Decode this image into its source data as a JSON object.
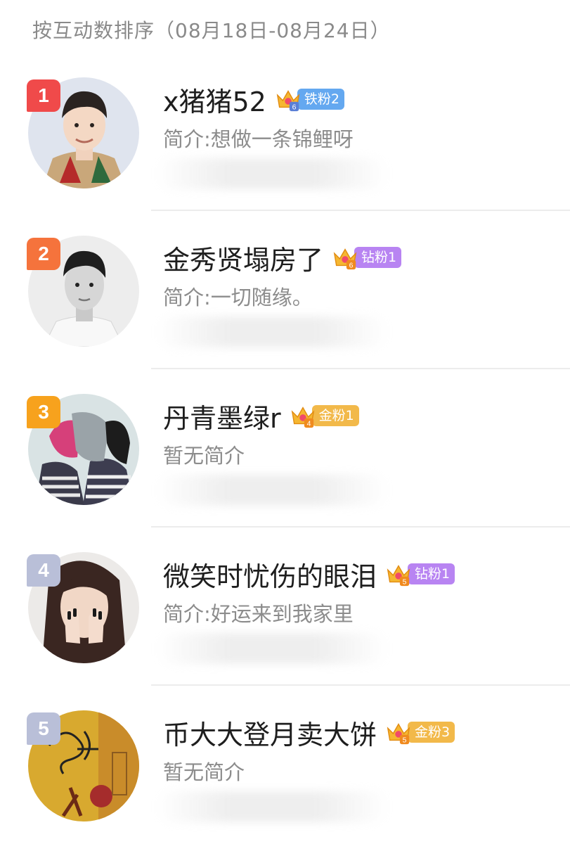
{
  "header": {
    "title": "按互动数排序（08月18日-08月24日）"
  },
  "colors": {
    "rank_1": "#f04a4a",
    "rank_2": "#f5733c",
    "rank_3": "#f7a21d",
    "rank_4_5": "#b9bfd8",
    "badge_iron": "#64a8f0",
    "badge_diamond": "#b884f2",
    "badge_gold": "#f2b94a"
  },
  "fans": [
    {
      "rank": "1",
      "name": "x猪猪52",
      "crown_level": "6",
      "badge": "铁粉2",
      "badge_type": "iron",
      "intro": "简介:想做一条锦鲤呀",
      "avatar": "boy-smiling"
    },
    {
      "rank": "2",
      "name": "金秀贤塌房了",
      "crown_level": "6",
      "badge": "钻粉1",
      "badge_type": "diamond",
      "intro": "简介:一切随缘。",
      "avatar": "man-bw"
    },
    {
      "rank": "3",
      "name": "丹青墨绿r",
      "crown_level": "4",
      "badge": "金粉1",
      "badge_type": "gold",
      "intro": "暂无简介",
      "avatar": "couple"
    },
    {
      "rank": "4",
      "name": "微笑时忧伤的眼泪",
      "crown_level": "5",
      "badge": "钻粉1",
      "badge_type": "diamond",
      "intro": "简介:好运来到我家里",
      "avatar": "woman-hands"
    },
    {
      "rank": "5",
      "name": "币大大登月卖大饼",
      "crown_level": "5",
      "badge": "金粉3",
      "badge_type": "gold",
      "intro": "暂无简介",
      "avatar": "paper-scribble"
    }
  ]
}
